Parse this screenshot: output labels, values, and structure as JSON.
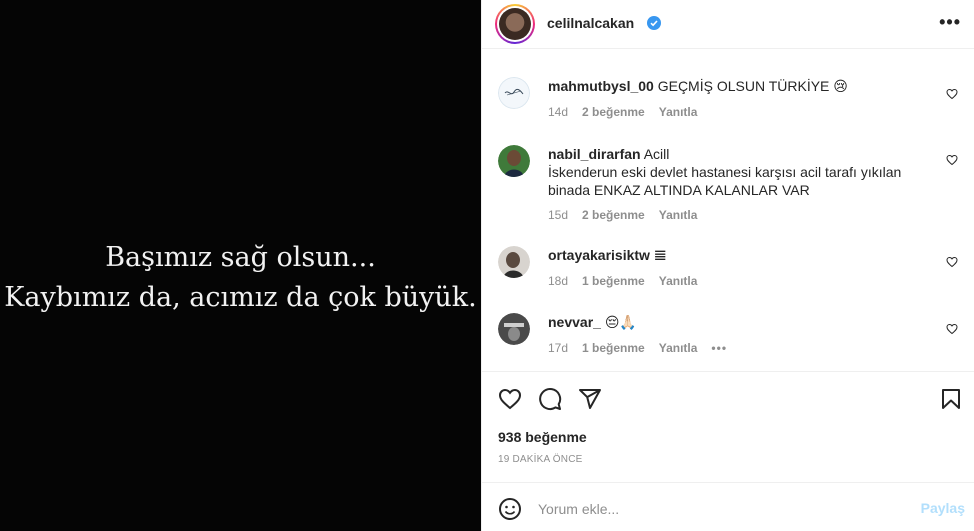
{
  "media": {
    "caption_line1": "Başımız sağ olsun...",
    "caption_line2": "Kaybımız da, acımız da çok büyük."
  },
  "header": {
    "username": "celilnalcakan",
    "verified_icon": "verified-badge-icon",
    "more_icon": "more-options-icon",
    "more_label": "•••"
  },
  "comments": [
    {
      "username": "mahmutbysl_00",
      "text": "GEÇMİŞ OLSUN TÜRKİYE 😢",
      "time": "14d",
      "likes": "2 beğenme",
      "reply": "Yanıtla"
    },
    {
      "username": "nabil_dirarfan",
      "text_line1": "Acill",
      "text_line2": "İskenderun eski devlet hastanesi karşısı acil tarafı yıkılan",
      "text_line3": "binada ENKAZ ALTINDA KALANLAR VAR",
      "time": "15d",
      "likes": "2 beğenme",
      "reply": "Yanıtla"
    },
    {
      "username": "ortayakarisiktw",
      "text": "𝌆",
      "time": "18d",
      "likes": "1 beğenme",
      "reply": "Yanıtla"
    },
    {
      "username": "nevvar_",
      "text": "😔🙏🏻",
      "time": "17d",
      "likes": "1 beğenme",
      "reply": "Yanıtla",
      "more": "•••"
    }
  ],
  "actions": {
    "like_icon": "heart-icon",
    "comment_icon": "comment-icon",
    "share_icon": "send-icon",
    "save_icon": "bookmark-icon",
    "likes_count": "938 beğenme",
    "timestamp": "19 DAKİKA ÖNCE"
  },
  "add_comment": {
    "emoji_icon": "emoji-icon",
    "placeholder": "Yorum ekle...",
    "post_label": "Paylaş"
  },
  "colors": {
    "post_button_disabled": "#b2dffc",
    "muted_text": "#8e8e8e",
    "verified_blue": "#3897f0"
  }
}
